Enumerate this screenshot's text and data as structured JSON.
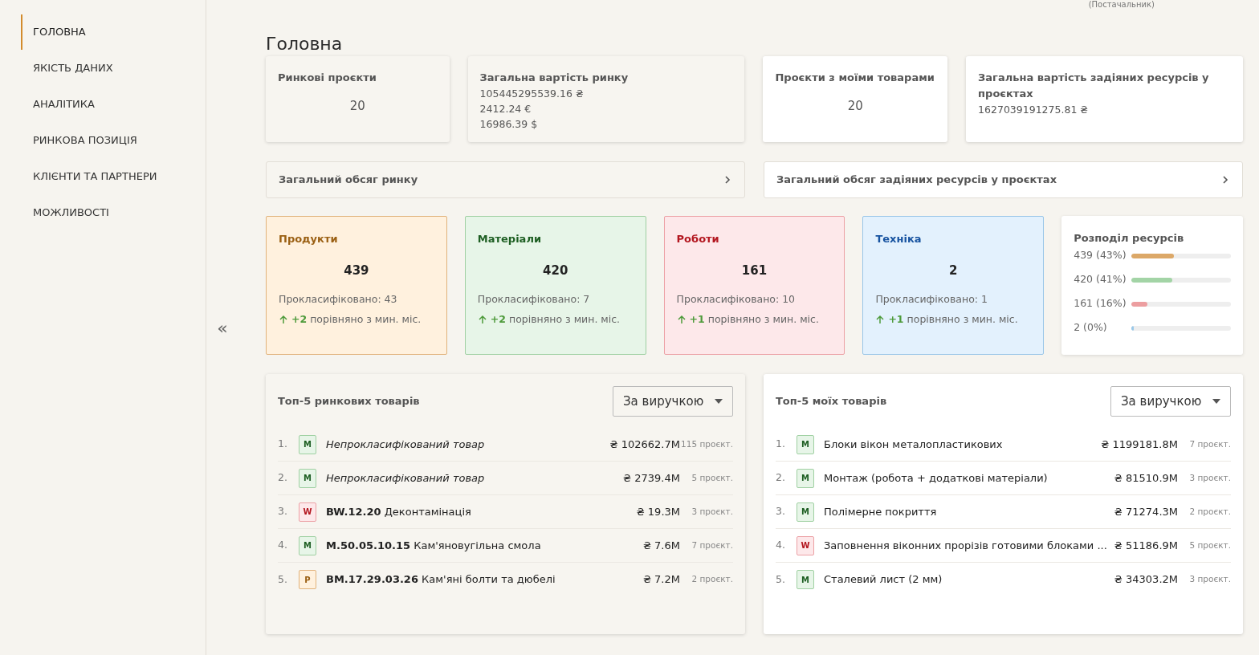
{
  "header": {
    "role": "(Постачальник)"
  },
  "sidebar": {
    "items": [
      {
        "label": "ГОЛОВНА",
        "selected": true
      },
      {
        "label": "ЯКІСТЬ ДАНИХ",
        "selected": false
      },
      {
        "label": "АНАЛІТИКА",
        "selected": false
      },
      {
        "label": "РИНКОВА ПОЗИЦІЯ",
        "selected": false
      },
      {
        "label": "КЛІЄНТИ ТА ПАРТНЕРИ",
        "selected": false
      },
      {
        "label": "МОЖЛИВОСТІ",
        "selected": false
      }
    ],
    "collapse": "«"
  },
  "page_title": "Головна",
  "summary_cards": [
    {
      "kind": "market",
      "title": "Ринкові проєкти",
      "value": "20"
    },
    {
      "kind": "market",
      "title": "Загальна вартість ринку",
      "lines": [
        "105445295539.16 ₴",
        "2412.24 €",
        "16986.39 $"
      ]
    },
    {
      "kind": "mine",
      "title": "Проєкти з моїми товарами",
      "value": "20"
    },
    {
      "kind": "mine",
      "title": "Загальна вартість задіяних ресурсів у проєктах",
      "lines": [
        "1627039191275.81 ₴"
      ]
    }
  ],
  "expanders": [
    {
      "kind": "market",
      "title": "Загальний обсяг ринку",
      "expanded": false
    },
    {
      "kind": "mine",
      "title": "Загальний обсяг задіяних ресурсів у проєктах",
      "expanded": false
    }
  ],
  "categories": [
    {
      "kind": "products",
      "title": "Продукти",
      "count": "439",
      "classified": "Прокласифіковано: 43",
      "delta": "+2",
      "delta_text": "порівняно з мин. міс."
    },
    {
      "kind": "materials",
      "title": "Матеріали",
      "count": "420",
      "classified": "Прокласифіковано: 7",
      "delta": "+2",
      "delta_text": "порівняно з мин. міс."
    },
    {
      "kind": "works",
      "title": "Роботи",
      "count": "161",
      "classified": "Прокласифіковано: 10",
      "delta": "+1",
      "delta_text": "порівняно з мин. міс."
    },
    {
      "kind": "equipment",
      "title": "Техніка",
      "count": "2",
      "classified": "Прокласифіковано: 1",
      "delta": "+1",
      "delta_text": "порівняно з мин. міс."
    }
  ],
  "distribution": {
    "title": "Розподіл ресурсів",
    "rows": [
      {
        "label": "439 (43%)",
        "level": 0.43,
        "color": "#dca868"
      },
      {
        "label": "420 (41%)",
        "level": 0.41,
        "color": "#a3d4a6"
      },
      {
        "label": "161 (16%)",
        "level": 0.16,
        "color": "#ec9ea0"
      },
      {
        "label": "2 (0%)",
        "level": 0.0,
        "color": "#9ac8e8"
      }
    ]
  },
  "top_lists": [
    {
      "kind": "market",
      "title": "Топ-5 ринкових товарів",
      "sort": "За виручкою",
      "rows": [
        {
          "rank": "1.",
          "kind": "materials",
          "badge": "М",
          "unclassified": true,
          "name": "Непрокласифікований товар",
          "value": "₴ 102662.7M",
          "projects": "115 проєкт."
        },
        {
          "rank": "2.",
          "kind": "materials",
          "badge": "М",
          "unclassified": true,
          "name": "Непрокласифікований товар",
          "value": "₴ 2739.4M",
          "projects": "5 проєкт."
        },
        {
          "rank": "3.",
          "kind": "works",
          "badge": "W",
          "unclassified": false,
          "code": "BW.12.20",
          "name": "Деконтамінація",
          "value": "₴ 19.3M",
          "projects": "3 проєкт."
        },
        {
          "rank": "4.",
          "kind": "materials",
          "badge": "М",
          "unclassified": false,
          "code": "M.50.05.10.15",
          "name": "Кам'яновугільна смола",
          "value": "₴ 7.6M",
          "projects": "7 проєкт."
        },
        {
          "rank": "5.",
          "kind": "products",
          "badge": "Р",
          "unclassified": false,
          "code": "BM.17.29.03.26",
          "name": "Кам'яні болти та дюбелі",
          "value": "₴ 7.2M",
          "projects": "2 проєкт."
        }
      ]
    },
    {
      "kind": "mine",
      "title": "Топ-5 моїх товарів",
      "sort": "За виручкою",
      "rows": [
        {
          "rank": "1.",
          "kind": "materials",
          "badge": "М",
          "unclassified": false,
          "name": "Блоки вікон металопластикових",
          "value": "₴ 1199181.8M",
          "projects": "7 проєкт."
        },
        {
          "rank": "2.",
          "kind": "materials",
          "badge": "М",
          "unclassified": false,
          "name": "Монтаж (робота + додаткові матеріали)",
          "value": "₴ 81510.9M",
          "projects": "3 проєкт."
        },
        {
          "rank": "3.",
          "kind": "materials",
          "badge": "М",
          "unclassified": false,
          "name": "Полімерне покриття",
          "value": "₴ 71274.3M",
          "projects": "2 проєкт."
        },
        {
          "rank": "4.",
          "kind": "works",
          "badge": "W",
          "unclassified": false,
          "name": "Заповнення віконних прорізів готовими блоками ...",
          "value": "₴ 51186.9M",
          "projects": "5 проєкт."
        },
        {
          "rank": "5.",
          "kind": "materials",
          "badge": "М",
          "unclassified": false,
          "name": "Сталевий лист (2 мм)",
          "value": "₴ 34303.2M",
          "projects": "3 проєкт."
        }
      ]
    }
  ]
}
